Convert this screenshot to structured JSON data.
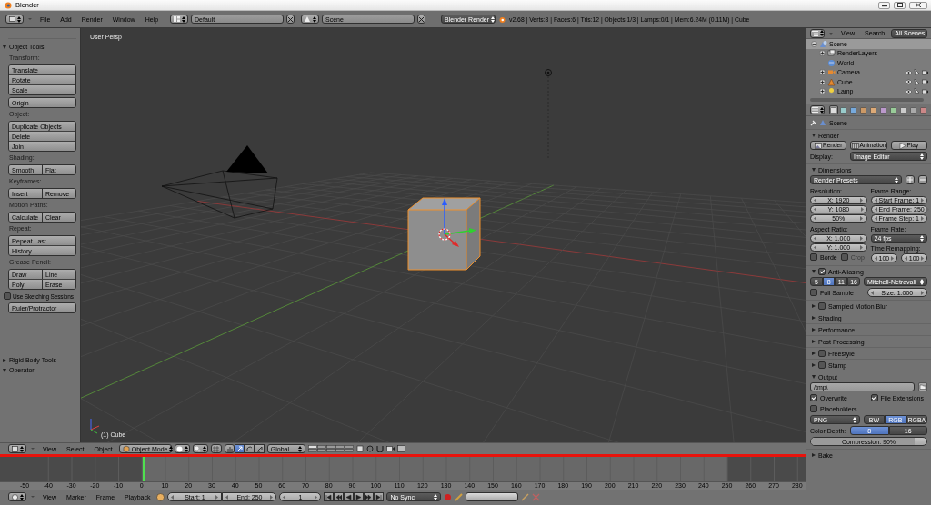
{
  "title_bar": {
    "title": "Blender"
  },
  "info_header": {
    "menus": [
      "File",
      "Add",
      "Render",
      "Window",
      "Help"
    ],
    "screen_layout": "Default",
    "scene": "Scene",
    "render_engine": "Blender Render",
    "stats": "v2.68 | Verts:8 | Faces:6 | Tris:12 | Objects:1/3 | Lamps:0/1 | Mem:6.24M (0.11M) | Cube"
  },
  "tool_shelf": {
    "panels": [
      {
        "title": "Object Tools",
        "expanded": true,
        "items": [
          {
            "kind": "heading",
            "text": "Transform:"
          },
          {
            "kind": "buttons",
            "rows": [
              [
                "Translate"
              ],
              [
                "Rotate"
              ],
              [
                "Scale"
              ]
            ]
          },
          {
            "kind": "buttons",
            "rows": [
              [
                "Origin"
              ]
            ]
          },
          {
            "kind": "heading",
            "text": "Object:"
          },
          {
            "kind": "buttons",
            "rows": [
              [
                "Duplicate Objects"
              ],
              [
                "Delete"
              ],
              [
                "Join"
              ]
            ]
          },
          {
            "kind": "heading",
            "text": "Shading:"
          },
          {
            "kind": "buttons",
            "rows": [
              [
                "Smooth",
                "Flat"
              ]
            ]
          },
          {
            "kind": "heading",
            "text": "Keyframes:"
          },
          {
            "kind": "buttons",
            "rows": [
              [
                "Insert",
                "Remove"
              ]
            ]
          },
          {
            "kind": "heading",
            "text": "Motion Paths:"
          },
          {
            "kind": "buttons",
            "rows": [
              [
                "Calculate",
                "Clear"
              ]
            ]
          },
          {
            "kind": "heading",
            "text": "Repeat:"
          },
          {
            "kind": "buttons",
            "rows": [
              [
                "Repeat Last"
              ],
              [
                "History..."
              ]
            ]
          },
          {
            "kind": "heading",
            "text": "Grease Pencil:"
          },
          {
            "kind": "buttons",
            "rows": [
              [
                "Draw",
                "Line"
              ],
              [
                "Poly",
                "Erase"
              ]
            ]
          },
          {
            "kind": "checkbox",
            "text": "Use Sketching Sessions",
            "checked": false
          },
          {
            "kind": "buttons",
            "rows": [
              [
                "Ruler/Protractor"
              ]
            ]
          }
        ]
      },
      {
        "title": "Rigid Body Tools",
        "expanded": false
      },
      {
        "title": "Operator",
        "expanded": true
      }
    ]
  },
  "viewport": {
    "view_name": "User Persp",
    "object_info": "(1) Cube"
  },
  "viewport_header": {
    "menus": [
      "View",
      "Select",
      "Object"
    ],
    "mode": "Object Mode",
    "manipulator_buttons": [
      {
        "selected": false
      },
      {
        "selected": true
      },
      {
        "selected": false
      },
      {
        "selected": false
      }
    ],
    "orientation": "Global"
  },
  "timeline": {
    "ruler": [
      "-50",
      "-40",
      "-30",
      "-20",
      "-10",
      "0",
      "10",
      "20",
      "30",
      "40",
      "50",
      "60",
      "70",
      "80",
      "90",
      "100",
      "110",
      "120",
      "130",
      "140",
      "150",
      "160",
      "170",
      "180",
      "190",
      "200",
      "210",
      "220",
      "230",
      "240",
      "250",
      "260",
      "270",
      "280"
    ]
  },
  "timeline_header": {
    "menus": [
      "View",
      "Marker",
      "Frame",
      "Playback"
    ],
    "start": "Start: 1",
    "end": "End: 250",
    "current_frame": "1",
    "sync": "No Sync"
  },
  "outliner": {
    "menus": [
      "View",
      "Search"
    ],
    "display_mode": "All Scenes",
    "tree": [
      {
        "kind": "scene",
        "label": "Scene",
        "selected": true,
        "expanded": true,
        "children": [
          {
            "kind": "render_layers",
            "label": "RenderLayers",
            "selected": false,
            "expanded": false
          },
          {
            "kind": "world",
            "label": "World",
            "selected": false
          },
          {
            "kind": "camera",
            "label": "Camera",
            "selected": false,
            "expanded": false
          },
          {
            "kind": "mesh",
            "label": "Cube",
            "selected": false,
            "expanded": false
          },
          {
            "kind": "lamp",
            "label": "Lamp",
            "selected": false,
            "expanded": false
          }
        ]
      }
    ]
  },
  "properties": {
    "context_tabs": [
      {
        "selected": true
      },
      {
        "selected": false
      },
      {
        "selected": false
      },
      {
        "selected": false
      },
      {
        "selected": false
      },
      {
        "selected": false
      },
      {
        "selected": false
      },
      {
        "selected": false
      },
      {
        "selected": false
      },
      {
        "selected": false
      }
    ],
    "breadcrumb": "Scene",
    "panels": [
      {
        "title": "Render",
        "expanded": true,
        "rows": [
          [
            {
              "kind": "button",
              "text": "Render"
            },
            {
              "kind": "button",
              "text": "Animation"
            },
            {
              "kind": "button",
              "text": "Play"
            }
          ],
          [
            {
              "kind": "label",
              "text": "Display:"
            },
            {
              "kind": "menu",
              "text": "Image Editor"
            }
          ]
        ]
      },
      {
        "title": "Dimensions",
        "expanded": true,
        "rows": [
          [
            {
              "kind": "preset_menu",
              "text": "Render Presets"
            }
          ],
          [
            {
              "kind": "column",
              "items": [
                {
                  "kind": "label",
                  "text": "Resolution:"
                },
                {
                  "kind": "number",
                  "text": "X: 1920"
                },
                {
                  "kind": "number",
                  "text": "Y: 1080"
                },
                {
                  "kind": "number",
                  "text": "50%"
                }
              ]
            },
            {
              "kind": "column",
              "items": [
                {
                  "kind": "label",
                  "text": "Frame Range:"
                },
                {
                  "kind": "number",
                  "text": "Start Frame: 1"
                },
                {
                  "kind": "number",
                  "text": "End Frame: 250"
                },
                {
                  "kind": "number",
                  "text": "Frame Step: 1"
                }
              ]
            }
          ],
          [
            {
              "kind": "column",
              "items": [
                {
                  "kind": "label",
                  "text": "Aspect Ratio:"
                },
                {
                  "kind": "number",
                  "text": "X: 1.000"
                },
                {
                  "kind": "number",
                  "text": "Y: 1.000"
                },
                {
                  "kind": "row",
                  "items": [
                    {
                      "kind": "checkbox",
                      "text": "Borde",
                      "checked": false
                    },
                    {
                      "kind": "checkbox",
                      "text": "Crop",
                      "checked": false,
                      "disabled": true
                    }
                  ]
                }
              ]
            },
            {
              "kind": "column",
              "items": [
                {
                  "kind": "label",
                  "text": "Frame Rate:"
                },
                {
                  "kind": "menu",
                  "text": "24 fps"
                },
                {
                  "kind": "label",
                  "text": "Time Remapping:"
                },
                {
                  "kind": "row",
                  "items": [
                    {
                      "kind": "number",
                      "text": "100"
                    },
                    {
                      "kind": "number",
                      "text": "100"
                    }
                  ]
                }
              ]
            }
          ]
        ]
      },
      {
        "title": "Anti-Aliasing",
        "expanded": true,
        "checked": true,
        "rows": [
          [
            {
              "kind": "segmented",
              "options": [
                {
                  "label": "5",
                  "selected": false
                },
                {
                  "label": "8",
                  "selected": true
                },
                {
                  "label": "11",
                  "selected": false
                },
                {
                  "label": "16",
                  "selected": false
                }
              ]
            },
            {
              "kind": "menu",
              "text": "Mitchell-Netravali"
            }
          ],
          [
            {
              "kind": "checkbox",
              "text": "Full Sample",
              "checked": false
            },
            {
              "kind": "number",
              "text": "Size: 1.000"
            }
          ]
        ]
      },
      {
        "title": "Sampled Motion Blur",
        "expanded": false,
        "checked": false
      },
      {
        "title": "Shading",
        "expanded": false
      },
      {
        "title": "Performance",
        "expanded": false
      },
      {
        "title": "Post Processing",
        "expanded": false
      },
      {
        "title": "Freestyle",
        "expanded": false,
        "checked": false
      },
      {
        "title": "Stamp",
        "expanded": false,
        "checked": false
      },
      {
        "title": "Output",
        "expanded": true,
        "rows": [
          [
            {
              "kind": "field",
              "text": "/tmp\\"
            }
          ],
          [
            {
              "kind": "checkbox",
              "text": "Overwrite",
              "checked": true
            },
            {
              "kind": "checkbox",
              "text": "File Extensions",
              "checked": true
            }
          ],
          [
            {
              "kind": "checkbox",
              "text": "Placeholders",
              "checked": false
            }
          ],
          [
            {
              "kind": "menu",
              "text": "PNG"
            },
            {
              "kind": "segmented",
              "options": [
                {
                  "label": "BW",
                  "selected": false
                },
                {
                  "label": "RGB",
                  "selected": true
                },
                {
                  "label": "RGBA",
                  "selected": false
                }
              ]
            }
          ],
          [
            {
              "kind": "label",
              "text": "Color Depth:"
            },
            {
              "kind": "segmented",
              "options": [
                {
                  "label": "8",
                  "selected": true
                },
                {
                  "label": "16",
                  "selected": false
                }
              ]
            }
          ],
          [
            {
              "kind": "slider",
              "text": "Compression: 90%",
              "level": 0.9
            }
          ]
        ]
      },
      {
        "title": "Bake",
        "expanded": false
      }
    ]
  }
}
